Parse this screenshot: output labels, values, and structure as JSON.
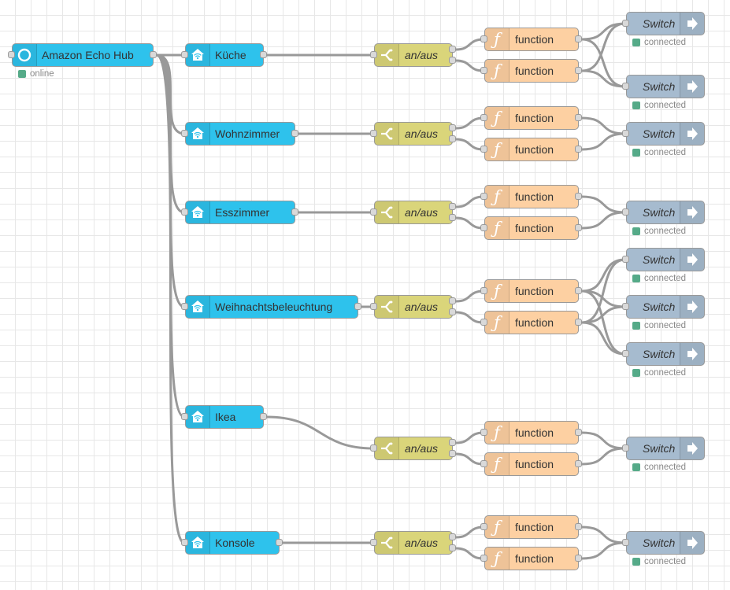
{
  "hub": {
    "label": "Amazon Echo Hub",
    "status": "online"
  },
  "devices": [
    {
      "label": "Küche"
    },
    {
      "label": "Wohnzimmer"
    },
    {
      "label": "Esszimmer"
    },
    {
      "label": "Weihnachtsbeleuchtung"
    },
    {
      "label": "Ikea"
    },
    {
      "label": "Konsole"
    }
  ],
  "switch_label": "an/aus",
  "function_label": "function",
  "output_label": "Switch",
  "output_status": "connected",
  "colors": {
    "hub": "#2ec2ec",
    "device": "#2ec2ec",
    "switch": "#dad57a",
    "function": "#fdd0a2",
    "output": "#a6bbcf",
    "status_dot": "#55aa88",
    "wire": "#999999"
  },
  "icons": {
    "hub": "alexa-ring-icon",
    "device": "smart-home-icon",
    "switch": "switch-branch-icon",
    "function": "function-icon",
    "output": "arrow-right-icon"
  }
}
